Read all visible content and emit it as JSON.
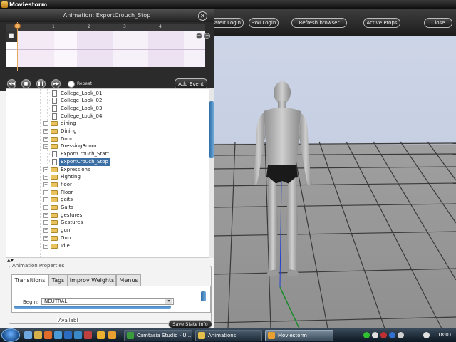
{
  "app": {
    "title": "Moviestorm"
  },
  "toolbar": {
    "buttons": [
      "ShareIt Login",
      "SWI Login",
      "Refresh browser",
      "Active Props",
      "Close"
    ]
  },
  "animation_panel": {
    "title": "Animation: ExportCrouch_Stop",
    "close_glyph": "✕",
    "timeline": {
      "ticks": [
        "1",
        "2",
        "3",
        "4"
      ],
      "zoom_in": "+",
      "zoom_out": "−"
    },
    "transport": {
      "buttons": [
        "rewind",
        "stop",
        "pause",
        "fast-forward"
      ],
      "repeat_label": "Repeat",
      "add_event_label": "Add Event"
    }
  },
  "tree": {
    "items": [
      {
        "label": "College_Look_01",
        "type": "file",
        "level": 1
      },
      {
        "label": "College_Look_02",
        "type": "file",
        "level": 1
      },
      {
        "label": "College_Look_03",
        "type": "file",
        "level": 1
      },
      {
        "label": "College_Look_04",
        "type": "file",
        "level": 1
      },
      {
        "label": "dining",
        "type": "folder",
        "level": 0
      },
      {
        "label": "Dining",
        "type": "folder",
        "level": 0
      },
      {
        "label": "Door",
        "type": "folder",
        "level": 0
      },
      {
        "label": "DressingRoom",
        "type": "folder",
        "level": 0,
        "expanded": true
      },
      {
        "label": "ExportCrouch_Start",
        "type": "file",
        "level": 1
      },
      {
        "label": "ExportCrouch_Stop",
        "type": "file",
        "level": 1,
        "selected": true
      },
      {
        "label": "Expressions",
        "type": "folder",
        "level": 0
      },
      {
        "label": "Fighting",
        "type": "folder",
        "level": 0
      },
      {
        "label": "floor",
        "type": "folder",
        "level": 0
      },
      {
        "label": "Floor",
        "type": "folder",
        "level": 0
      },
      {
        "label": "gaits",
        "type": "folder",
        "level": 0
      },
      {
        "label": "Gaits",
        "type": "folder",
        "level": 0
      },
      {
        "label": "gestures",
        "type": "folder",
        "level": 0
      },
      {
        "label": "Gestures",
        "type": "folder",
        "level": 0
      },
      {
        "label": "gun",
        "type": "folder",
        "level": 0
      },
      {
        "label": "Gun",
        "type": "folder",
        "level": 0
      },
      {
        "label": "Idle",
        "type": "folder",
        "level": 0
      }
    ],
    "expand_glyph": "+",
    "collapse_glyph": "−",
    "scroll_arrows": "▲▼"
  },
  "properties": {
    "legend": "Animation Properties",
    "tabs": [
      "Transitions",
      "Tags",
      "Improv Weights",
      "Menus"
    ],
    "active_tab": 0,
    "begin_label": "Begin:",
    "begin_value": "NEUTRAL",
    "dropdown_glyph": "▾",
    "available_label": "Availabl",
    "save_state_label": "Save State Info"
  },
  "taskbar": {
    "tasks": [
      {
        "label": "Camtasia Studio - U...",
        "icon_color": "#3a9c3a"
      },
      {
        "label": "Animations",
        "icon_color": "#e2c04a"
      },
      {
        "label": "Moviestorm",
        "icon_color": "#e8a030",
        "active": true
      }
    ],
    "tray_icon_colors": [
      "#30c030",
      "#e0e0e0",
      "#c03030",
      "#3070d0",
      "#d0d0d0",
      "#e0e0e0"
    ],
    "clock": "18:01"
  },
  "colors": {
    "sky": "#c9d1e4",
    "floor": "#929292",
    "selection": "#3a6ea5",
    "playhead": "#e9a95a"
  }
}
